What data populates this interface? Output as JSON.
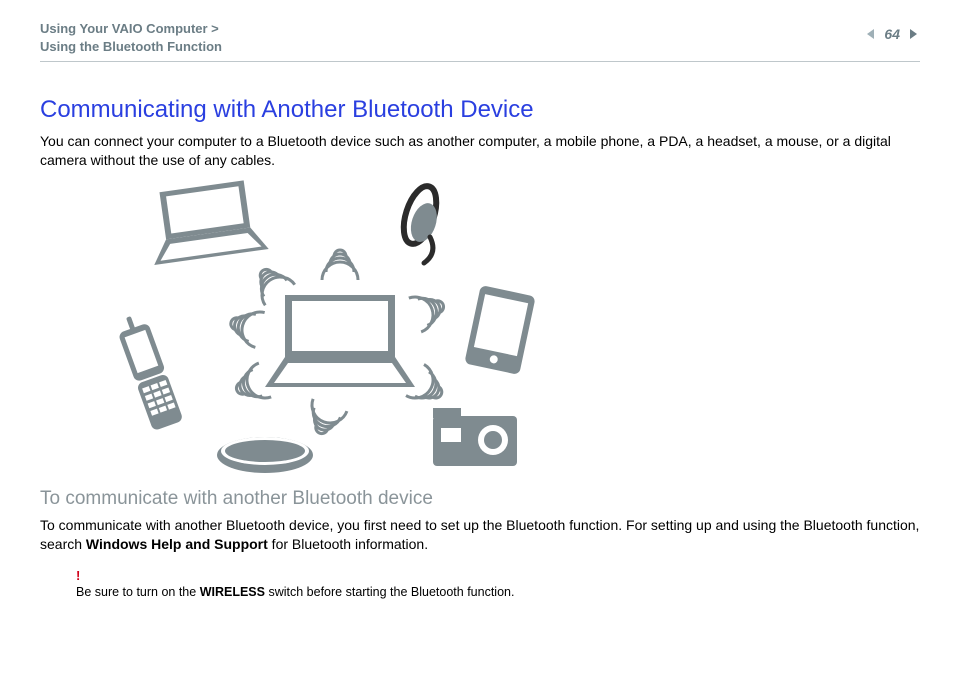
{
  "header": {
    "breadcrumb_line1": "Using Your VAIO Computer >",
    "breadcrumb_line2": "Using the Bluetooth Function",
    "page_number": "64"
  },
  "section": {
    "title": "Communicating with Another Bluetooth Device",
    "intro": "You can connect your computer to a Bluetooth device such as another computer, a mobile phone, a PDA, a headset, a mouse, or a digital camera without the use of any cables."
  },
  "subsection": {
    "heading": "To communicate with another Bluetooth device",
    "body_pre": "To communicate with another Bluetooth device, you first need to set up the Bluetooth function. For setting up and using the Bluetooth function, search ",
    "body_bold": "Windows Help and Support",
    "body_post": " for Bluetooth information."
  },
  "note": {
    "bang": "!",
    "pre": "Be sure to turn on the ",
    "bold": "WIRELESS",
    "post": " switch before starting the Bluetooth function."
  },
  "diagram": {
    "devices": [
      "laptop",
      "headset",
      "pda",
      "camera",
      "mouse",
      "flip-phone",
      "center-laptop"
    ]
  }
}
